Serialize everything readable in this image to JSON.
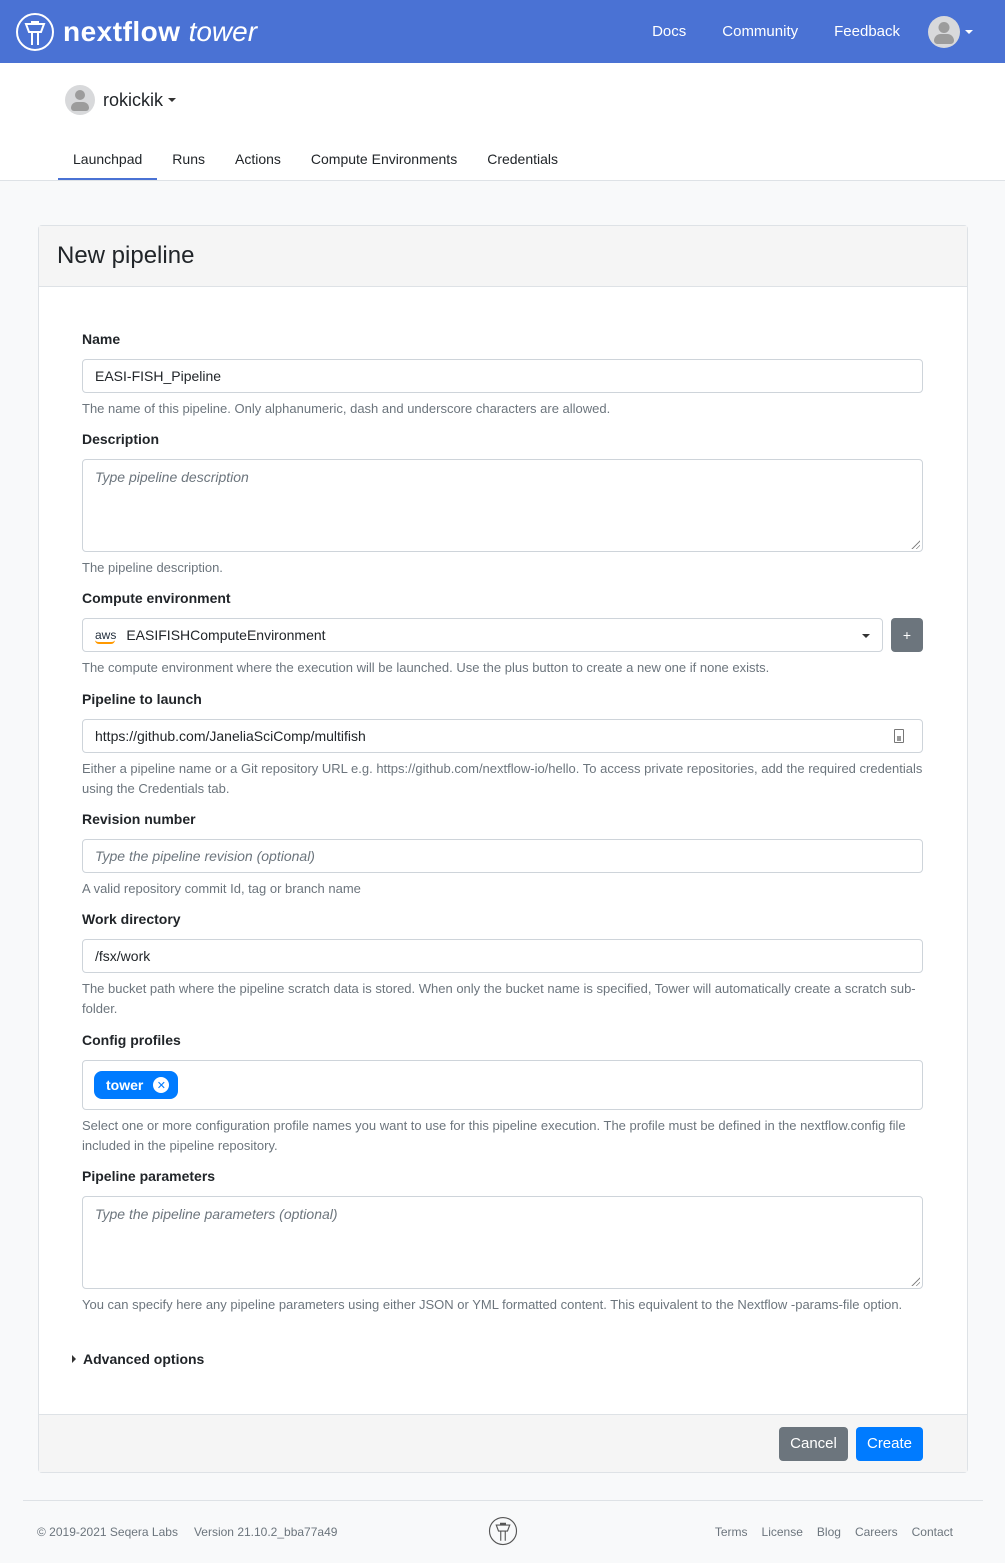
{
  "app": {
    "brand_main": "nextflow",
    "brand_sub": "tower"
  },
  "topnav": {
    "links": [
      "Docs",
      "Community",
      "Feedback"
    ]
  },
  "workspace": {
    "org_name": "rokickik"
  },
  "tabs": [
    {
      "label": "Launchpad",
      "active": true
    },
    {
      "label": "Runs",
      "active": false
    },
    {
      "label": "Actions",
      "active": false
    },
    {
      "label": "Compute Environments",
      "active": false
    },
    {
      "label": "Credentials",
      "active": false
    }
  ],
  "form": {
    "title": "New pipeline",
    "name": {
      "label": "Name",
      "value": "EASI-FISH_Pipeline",
      "help": "The name of this pipeline. Only alphanumeric, dash and underscore characters are allowed."
    },
    "description": {
      "label": "Description",
      "placeholder": "Type pipeline description",
      "help": "The pipeline description."
    },
    "compute_env": {
      "label": "Compute environment",
      "provider_icon": "aws",
      "value": "EASIFISHComputeEnvironment",
      "add_label": "+",
      "help": "The compute environment where the execution will be launched. Use the plus button to create a new one if none exists."
    },
    "pipeline": {
      "label": "Pipeline to launch",
      "value": "https://github.com/JaneliaSciComp/multifish",
      "help": "Either a pipeline name or a Git repository URL e.g. https://github.com/nextflow-io/hello. To access private repositories, add the required credentials using the Credentials tab."
    },
    "revision": {
      "label": "Revision number",
      "placeholder": "Type the pipeline revision (optional)",
      "help": "A valid repository commit Id, tag or branch name"
    },
    "workdir": {
      "label": "Work directory",
      "value": "/fsx/work",
      "help": "The bucket path where the pipeline scratch data is stored. When only the bucket name is specified, Tower will automatically create a scratch sub-folder."
    },
    "profiles": {
      "label": "Config profiles",
      "tags": [
        "tower"
      ],
      "help": "Select one or more configuration profile names you want to use for this pipeline execution. The profile must be defined in the nextflow.config file included in the pipeline repository."
    },
    "params": {
      "label": "Pipeline parameters",
      "placeholder": "Type the pipeline parameters (optional)",
      "help": "You can specify here any pipeline parameters using either JSON or YML formatted content. This equivalent to the Nextflow -params-file option."
    },
    "advanced_label": "Advanced options",
    "cancel_label": "Cancel",
    "create_label": "Create"
  },
  "footer": {
    "copyright": "© 2019-2021 Seqera Labs",
    "version": "Version 21.10.2_bba77a49",
    "links": [
      "Terms",
      "License",
      "Blog",
      "Careers",
      "Contact"
    ]
  },
  "colors": {
    "brand": "#4a72d4",
    "primary": "#007bff",
    "secondary": "#6c757d"
  }
}
